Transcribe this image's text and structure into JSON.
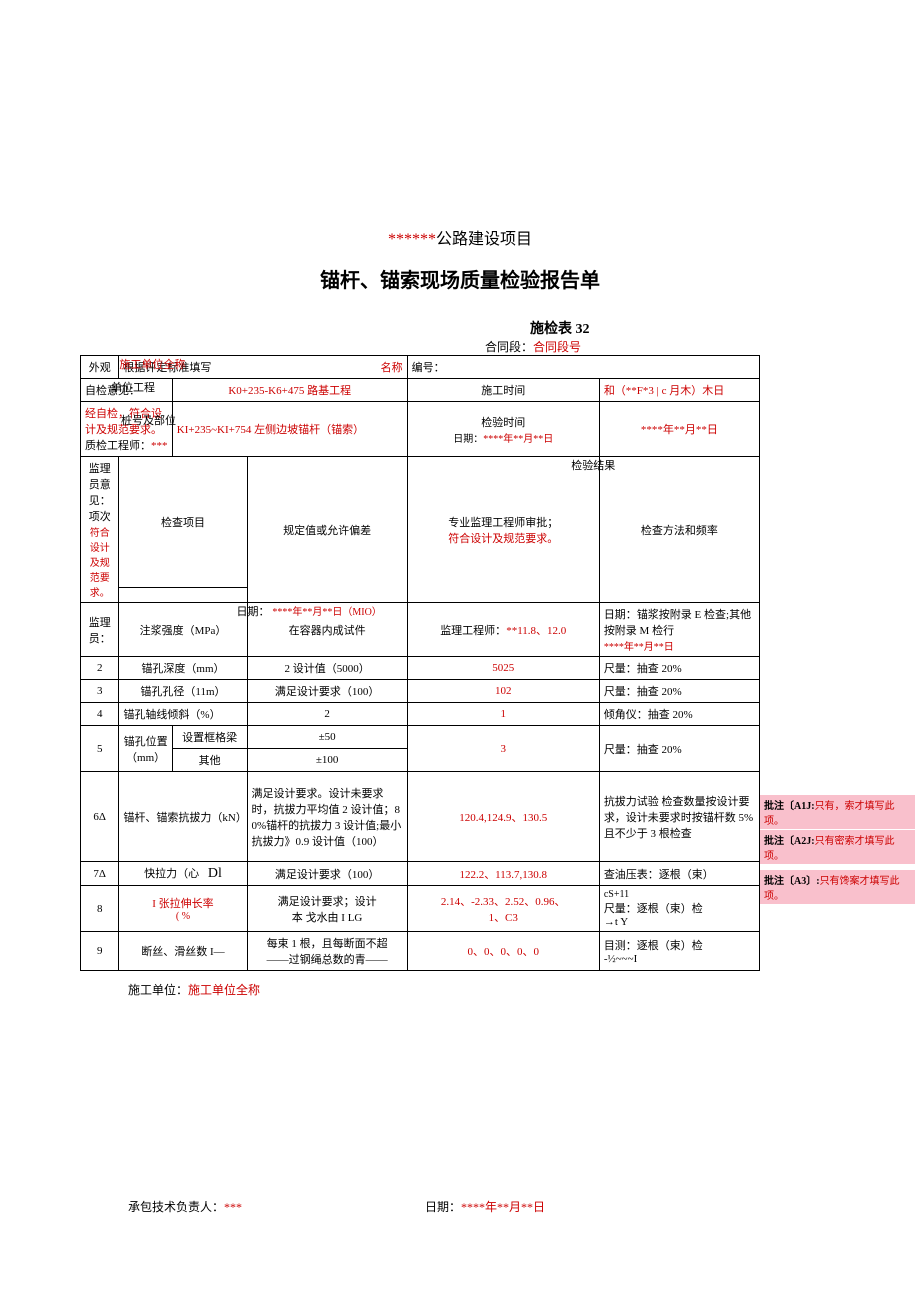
{
  "project_prefix": "******",
  "project_suffix": "公路建设项目",
  "title": "锚杆、锚索现场质量检验报告单",
  "form_name": "施检表 32",
  "contract_label": "合同段：",
  "contract_value": "合同段号",
  "header": {
    "r0": {
      "c0": "外观",
      "c1_a": "根据评定标准填写",
      "c1_b": "施工单位全称",
      "name_label": "名称",
      "num_label": "编号："
    },
    "r1": {
      "c0": "自检意见：",
      "unit_label": "单位工程",
      "unit_val": "K0+235-K6+475 路基工程",
      "time_label": "施工时间",
      "time_val": "和（**F*3 | c 月木）木日"
    },
    "r2": {
      "self_check": "经自检，符合设计及规范要求。",
      "eng_label": "质检工程师：",
      "eng_val": "***",
      "stake_label": "桩号及部位",
      "stake_val": "KI+235~KI+754 左侧边坡锚杆（锚索）",
      "check_time_label": "检验时间",
      "check_date_label": "日期：",
      "check_date_val": "****年**月**日"
    },
    "head_row": {
      "c0_a": "监理员意见：",
      "c0_b": "项次",
      "c1_a": "符合设计及规范要求。",
      "c1_b": "检查项目",
      "c2": "规定值或允许偏差",
      "c3_a": "专业监理工程师审批；",
      "c3_b": "符合设计及规范要求。",
      "c3_c": "检验结果",
      "c4": "检查方法和频率"
    }
  },
  "rows": [
    {
      "no": "",
      "no_over": "监理员：",
      "item": "注浆强度（MPa）",
      "item_over": "日期：",
      "spec": "在容器内成试件",
      "spec_over": "****年**月**日（MIO）",
      "result_pre": "监理工程师：",
      "result": "**11.8、12.0",
      "method_pre": "日期：",
      "method": "锚浆按附录 E 检查;其他按附录 M 检行",
      "method_over": "****年**月**日"
    },
    {
      "no": "2",
      "item": "锚孔深度（mm）",
      "spec": "2 设计值（5000）",
      "result": "5025",
      "method": "尺量：抽查 20%"
    },
    {
      "no": "3",
      "item": "锚孔孔径（11m）",
      "spec": "满足设计要求（100）",
      "result": "102",
      "method": "尺量：抽查 20%"
    },
    {
      "no": "4",
      "item": "锚孔轴线倾斜（%）",
      "spec": "2",
      "result": "1",
      "method": "倾角仪：抽查 20%"
    },
    {
      "no": "5",
      "item_top": "锚孔位置（mm）",
      "sub1": "设置框格梁",
      "spec1": "±50",
      "sub2": "其他",
      "spec2": "±100",
      "result": "3",
      "method": "尺量：抽查 20%"
    },
    {
      "no": "6Δ",
      "item": "锚杆、锚索抗拔力（kN）",
      "spec": "满足设计要求。设计未要求时，抗拔力平均值 2 设计值；80%锚杆的抗拔力 3 设计值;最小抗拔力》0.9 设计值（100）",
      "result": "120.4,124.9、130.5",
      "method": "抗拔力试验 检查数量按设计要求，设计未要求时按锚杆数 5%且不少于 3 根检查"
    },
    {
      "no": "7Δ",
      "item": "快拉力（心",
      "item_extra": "Dl",
      "spec": "满足设计要求（100）",
      "result": "122.2、113.7,130.8",
      "method": "查油压表：逐根（束）"
    },
    {
      "no": "8",
      "item": "I 张拉伸长率",
      "item_extra": "( %",
      "spec": "满足设计要求；设计",
      "spec2": "本 戈水由 I LG",
      "result": "2.14、-2.33、2.52、0.96、",
      "result2": "1、C3",
      "method_pre": "cS+11",
      "method": "尺量：逐根（束）检",
      "method2": "→t               Y"
    },
    {
      "no": "9",
      "item": "断丝、滑丝数 I—",
      "spec": "每束 1 根，且每断面不超",
      "spec2": "——过钢绳总数的青——",
      "result": "0、0、0、0、0",
      "method": "目测：逐根（束）检",
      "method2": "-½~~~I"
    }
  ],
  "construct_label": "施工单位：",
  "construct_value": "施工单位全称",
  "sign_label": "承包技术负责人：",
  "sign_value": "***",
  "date_label": "日期：",
  "date_value": "****年**月**日",
  "annotations": {
    "a1": {
      "tag": "批注〔A1J:",
      "text": "只有，索才填写此项。"
    },
    "a2": {
      "tag": "批注〔A2J:",
      "text": "只有密索才填写此项。"
    },
    "a3": {
      "tag": "批注〔A3〕:",
      "text": "只有馋案才填写此项。"
    }
  }
}
